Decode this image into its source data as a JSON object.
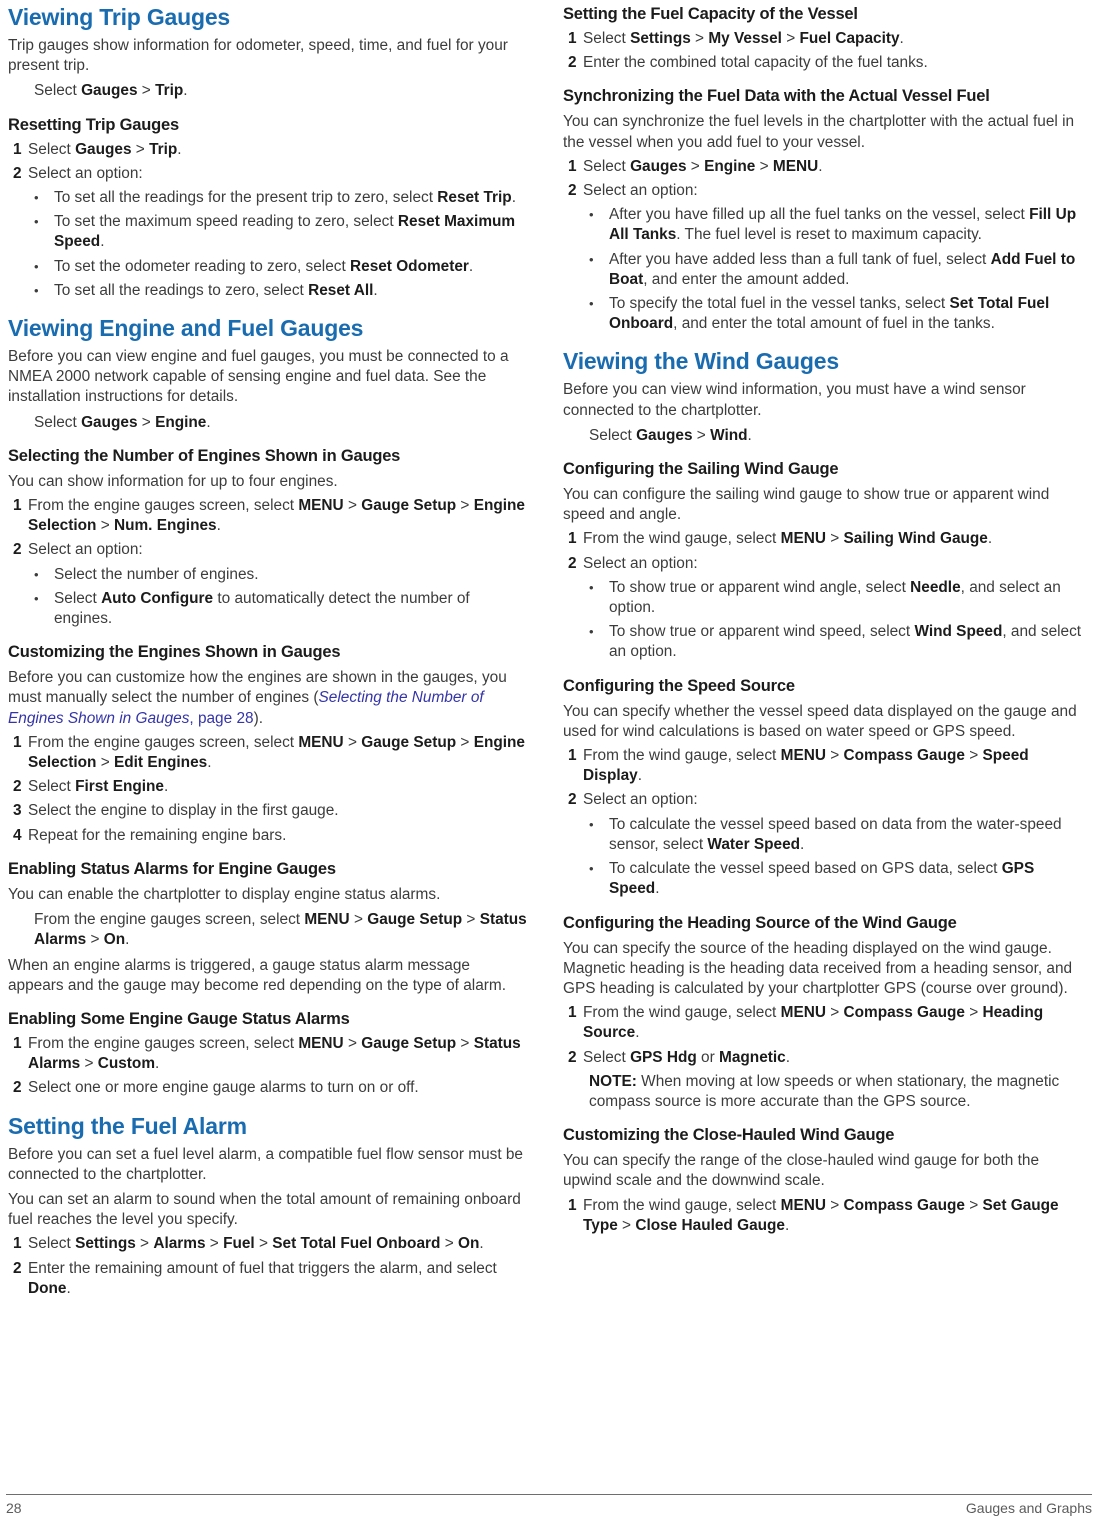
{
  "document": {
    "page_number": "28",
    "footer_title": "Gauges and Graphs",
    "accent_color": "#1a6cb0",
    "xref_color": "#3434a8",
    "body_color": "#3c3c3c"
  },
  "left_column": [
    {
      "type": "h1",
      "text": "Viewing Trip Gauges"
    },
    {
      "type": "para",
      "html": "Trip gauges show information for odometer, speed, time, and fuel for your present trip."
    },
    {
      "type": "step_plain",
      "html": "Select <b>Gauges</b> &gt; <b>Trip</b>."
    },
    {
      "type": "h2",
      "text": "Resetting Trip Gauges"
    },
    {
      "type": "ol_item",
      "num": "1",
      "html": "Select <b>Gauges</b> &gt; <b>Trip</b>."
    },
    {
      "type": "ol_item",
      "num": "2",
      "html": "Select an option:"
    },
    {
      "type": "ul_item",
      "html": "To set all the readings for the present trip to zero, select <b>Reset Trip</b>."
    },
    {
      "type": "ul_item",
      "html": "To set the maximum speed reading to zero, select <b>Reset Maximum Speed</b>."
    },
    {
      "type": "ul_item",
      "html": "To set the odometer reading to zero, select <b>Reset Odometer</b>."
    },
    {
      "type": "ul_item",
      "html": "To set all the readings to zero, select <b>Reset All</b>."
    },
    {
      "type": "h1",
      "text": "Viewing Engine and Fuel Gauges"
    },
    {
      "type": "para",
      "html": "Before you can view engine and fuel gauges, you must be connected to a NMEA 2000 network capable of sensing engine and fuel data. See the installation instructions for details."
    },
    {
      "type": "step_plain",
      "html": "Select <b>Gauges</b> &gt; <b>Engine</b>."
    },
    {
      "type": "h2",
      "text": "Selecting the Number of Engines Shown in Gauges"
    },
    {
      "type": "para",
      "html": "You can show information for up to four engines."
    },
    {
      "type": "ol_item",
      "num": "1",
      "html": "From the engine gauges screen, select <b>MENU</b> &gt; <b>Gauge Setup</b> &gt; <b>Engine Selection</b> &gt; <b>Num. Engines</b>."
    },
    {
      "type": "ol_item",
      "num": "2",
      "html": "Select an option:"
    },
    {
      "type": "ul_item",
      "html": "Select the number of engines."
    },
    {
      "type": "ul_item",
      "html": "Select <b>Auto Configure</b> to automatically detect the number of engines."
    },
    {
      "type": "h2",
      "text": "Customizing the Engines Shown in Gauges"
    },
    {
      "type": "para",
      "html": "Before you can customize how the engines are shown in the gauges, you must manually select the number of engines (<span class=\"xref\"><i>Selecting the Number of Engines Shown in Gauges</i>, page 28</span>)."
    },
    {
      "type": "ol_item",
      "num": "1",
      "html": "From the engine gauges screen, select <b>MENU</b> &gt; <b>Gauge Setup</b> &gt; <b>Engine Selection</b> &gt; <b>Edit Engines</b>."
    },
    {
      "type": "ol_item",
      "num": "2",
      "html": "Select <b>First Engine</b>."
    },
    {
      "type": "ol_item",
      "num": "3",
      "html": "Select the engine to display in the first gauge."
    },
    {
      "type": "ol_item",
      "num": "4",
      "html": "Repeat for the remaining engine bars."
    },
    {
      "type": "h2",
      "text": "Enabling Status Alarms for Engine Gauges"
    },
    {
      "type": "para",
      "html": "You can enable the chartplotter to display engine status alarms."
    },
    {
      "type": "step_plain",
      "html": "From the engine gauges screen, select <b>MENU</b> &gt; <b>Gauge Setup</b> &gt; <b>Status Alarms</b> &gt; <b>On</b>."
    },
    {
      "type": "para",
      "html": "When an engine alarms is triggered, a gauge status alarm message appears and the gauge may become red depending on the type of alarm."
    },
    {
      "type": "h2",
      "text": "Enabling Some Engine Gauge Status Alarms"
    },
    {
      "type": "ol_item",
      "num": "1",
      "html": "From the engine gauges screen, select <b>MENU</b> &gt; <b>Gauge Setup</b> &gt; <b>Status Alarms</b> &gt; <b>Custom</b>."
    },
    {
      "type": "ol_item",
      "num": "2",
      "html": "Select one or more engine gauge alarms to turn on or off."
    },
    {
      "type": "h1",
      "text": "Setting the Fuel Alarm"
    },
    {
      "type": "para",
      "html": "Before you can set a fuel level alarm, a compatible fuel flow sensor must be connected to the chartplotter."
    },
    {
      "type": "para",
      "html": "You can set an alarm to sound when the total amount of remaining onboard fuel reaches the level you specify."
    },
    {
      "type": "ol_item",
      "num": "1",
      "html": "Select <b>Settings</b> &gt; <b>Alarms</b> &gt; <b>Fuel</b> &gt; <b>Set Total Fuel Onboard</b> &gt; <b>On</b>."
    },
    {
      "type": "ol_item",
      "num": "2",
      "html": "Enter the remaining amount of fuel that triggers the alarm, and select <b>Done</b>."
    }
  ],
  "right_column": [
    {
      "type": "h2",
      "text": "Setting the Fuel Capacity of the Vessel"
    },
    {
      "type": "ol_item",
      "num": "1",
      "html": "Select <b>Settings</b> &gt; <b>My Vessel</b> &gt; <b>Fuel Capacity</b>."
    },
    {
      "type": "ol_item",
      "num": "2",
      "html": "Enter the combined total capacity of the fuel tanks."
    },
    {
      "type": "h2",
      "text": "Synchronizing the Fuel Data with the Actual Vessel Fuel"
    },
    {
      "type": "para",
      "html": "You can synchronize the fuel levels in the chartplotter with the actual fuel in the vessel when you add fuel to your vessel."
    },
    {
      "type": "ol_item",
      "num": "1",
      "html": "Select <b>Gauges</b> &gt; <b>Engine</b> &gt; <b>MENU</b>."
    },
    {
      "type": "ol_item",
      "num": "2",
      "html": "Select an option:"
    },
    {
      "type": "ul_item",
      "html": "After you have filled up all the fuel tanks on the vessel, select <b>Fill Up All Tanks</b>. The fuel level is reset to maximum capacity."
    },
    {
      "type": "ul_item",
      "html": "After you have added less than a full tank of fuel, select <b>Add Fuel to Boat</b>, and enter the amount added."
    },
    {
      "type": "ul_item",
      "html": "To specify the total fuel in the vessel tanks, select <b>Set Total Fuel Onboard</b>, and enter the total amount of fuel in the tanks."
    },
    {
      "type": "h1",
      "text": "Viewing the Wind Gauges"
    },
    {
      "type": "para",
      "html": "Before you can view wind information, you must have a wind sensor connected to the chartplotter."
    },
    {
      "type": "step_plain",
      "html": "Select <b>Gauges</b> &gt; <b>Wind</b>."
    },
    {
      "type": "h2",
      "text": "Configuring the Sailing Wind Gauge"
    },
    {
      "type": "para",
      "html": "You can configure the sailing wind gauge to show true or apparent wind speed and angle."
    },
    {
      "type": "ol_item",
      "num": "1",
      "html": "From the wind gauge, select <b>MENU</b> &gt; <b>Sailing Wind Gauge</b>."
    },
    {
      "type": "ol_item",
      "num": "2",
      "html": "Select an option:"
    },
    {
      "type": "ul_item",
      "html": "To show true or apparent wind angle, select <b>Needle</b>, and select an option."
    },
    {
      "type": "ul_item",
      "html": "To show true or apparent wind speed, select <b>Wind Speed</b>, and select an option."
    },
    {
      "type": "h2",
      "text": "Configuring the Speed Source"
    },
    {
      "type": "para",
      "html": "You can specify whether the vessel speed data displayed on the gauge and used for wind calculations is based on water speed or GPS speed."
    },
    {
      "type": "ol_item",
      "num": "1",
      "html": "From the wind gauge, select <b>MENU</b> &gt; <b>Compass Gauge</b> &gt; <b>Speed Display</b>."
    },
    {
      "type": "ol_item",
      "num": "2",
      "html": "Select an option:"
    },
    {
      "type": "ul_item",
      "html": "To calculate the vessel speed based on data from the water-speed sensor, select <b>Water Speed</b>."
    },
    {
      "type": "ul_item",
      "html": "To calculate the vessel speed based on GPS data, select <b>GPS Speed</b>."
    },
    {
      "type": "h2",
      "text": "Configuring the Heading Source of the Wind Gauge"
    },
    {
      "type": "para",
      "html": "You can specify the source of the heading displayed on the wind gauge. Magnetic heading is the heading data received from a heading sensor, and GPS heading is calculated by your chartplotter GPS (course over ground)."
    },
    {
      "type": "ol_item",
      "num": "1",
      "html": "From the wind gauge, select <b>MENU</b> &gt; <b>Compass Gauge</b> &gt; <b>Heading Source</b>."
    },
    {
      "type": "ol_item",
      "num": "2",
      "html": "Select <b>GPS Hdg</b> or <b>Magnetic</b>."
    },
    {
      "type": "note",
      "html": "<b>NOTE:</b> When moving at low speeds or when stationary, the magnetic compass source is more accurate than the GPS source."
    },
    {
      "type": "h2",
      "text": "Customizing the Close-Hauled Wind Gauge"
    },
    {
      "type": "para",
      "html": "You can specify the range of the close-hauled wind gauge for both the upwind scale and the downwind scale."
    },
    {
      "type": "ol_item",
      "num": "1",
      "html": "From the wind gauge, select <b>MENU</b> &gt; <b>Compass Gauge</b> &gt; <b>Set Gauge Type</b> &gt; <b>Close Hauled Gauge</b>."
    }
  ]
}
